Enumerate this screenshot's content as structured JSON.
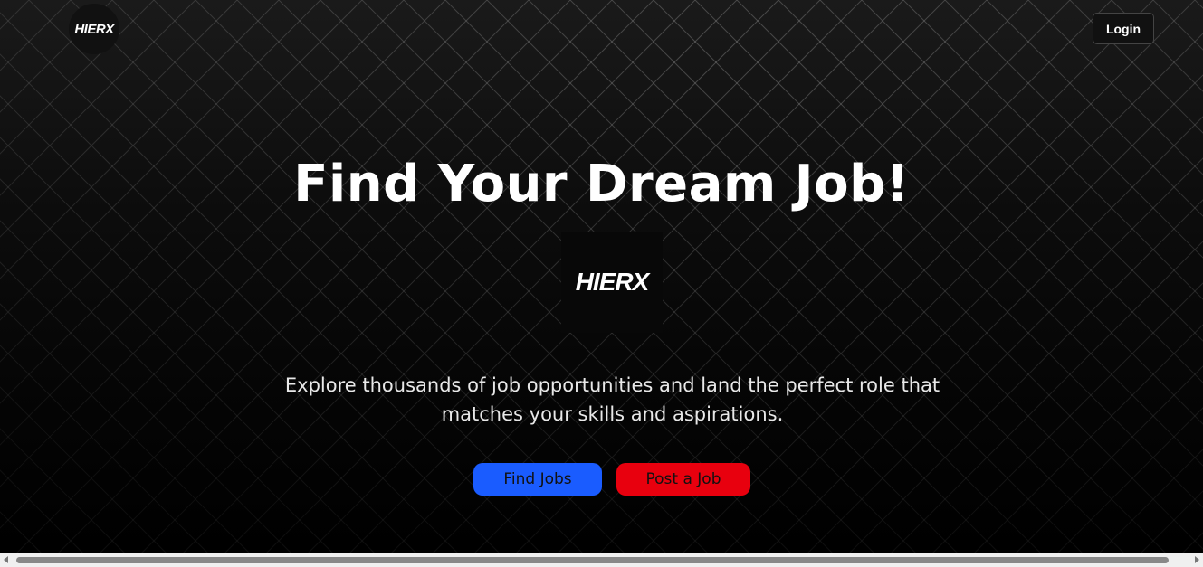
{
  "header": {
    "logo_text": "HIERX",
    "login_label": "Login"
  },
  "hero": {
    "headline": "Find Your Dream Job!",
    "center_logo_text": "HIERX",
    "description": "Explore thousands of job opportunities and land the perfect role that matches your skills and aspirations.",
    "find_jobs_label": "Find Jobs",
    "post_job_label": "Post a Job"
  },
  "colors": {
    "find_jobs_button": "#1a5cff",
    "post_job_button": "#e8000e",
    "background": "#000000"
  }
}
